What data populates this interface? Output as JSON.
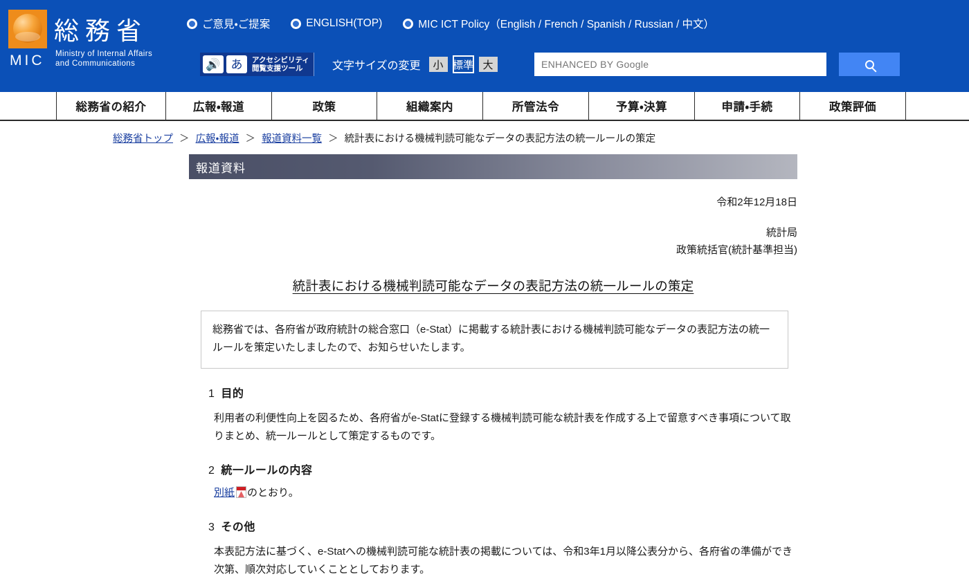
{
  "header": {
    "logo": {
      "mark_name": "mic-sphere-logo",
      "abbr": "MIC",
      "ministry_jp": "総務省",
      "ministry_en_line1": "Ministry of Internal Affairs",
      "ministry_en_line2": "and Communications"
    },
    "top_links": [
      {
        "label": "ご意見・ご提案"
      },
      {
        "label": "ENGLISH(TOP)"
      },
      {
        "label": "MIC ICT Policy（English / French / Spanish / Russian / 中文）"
      }
    ],
    "accessibility": {
      "speaker_glyph": "◀))",
      "kana_glyph": "あ",
      "label_line1": "アクセシビリティ",
      "label_line2": "閲覧支援ツール"
    },
    "font_size": {
      "label": "文字サイズの変更",
      "options": [
        {
          "label": "小",
          "selected": false
        },
        {
          "label": "標準",
          "selected": true
        },
        {
          "label": "大",
          "selected": false
        }
      ]
    },
    "search": {
      "placeholder": "ENHANCED BY Google",
      "value": "",
      "button_icon": "search-icon"
    },
    "colors": {
      "header_blue": "#0b50b7",
      "search_button_blue": "#4285f4",
      "logo_orange": "#ee8c1b"
    }
  },
  "global_nav": {
    "items": [
      {
        "label": "総務省の紹介",
        "width": 158
      },
      {
        "label": "広報・報道",
        "width": 153
      },
      {
        "label": "政策",
        "width": 152
      },
      {
        "label": "組織案内",
        "width": 153
      },
      {
        "label": "所管法令",
        "width": 153
      },
      {
        "label": "予算・決算",
        "width": 153
      },
      {
        "label": "申請・手続",
        "width": 152
      },
      {
        "label": "政策評価",
        "width": 153
      }
    ]
  },
  "breadcrumb": {
    "items": [
      {
        "label": "総務省トップ",
        "is_link": true
      },
      {
        "label": "広報・報道",
        "is_link": true
      },
      {
        "label": "報道資料一覧",
        "is_link": true
      },
      {
        "label": "統計表における機械判読可能なデータの表記方法の統一ルールの策定",
        "is_link": false
      }
    ],
    "separator": "＞"
  },
  "page": {
    "banner_label": "報道資料",
    "date": "令和2年12月18日",
    "issuer_line1": "統計局",
    "issuer_line2": "政策統括官(統計基準担当)",
    "title": "統計表における機械判読可能なデータの表記方法の統一ルールの策定",
    "summary": "総務省では、各府省が政府統計の総合窓口（e-Stat）に掲載する統計表における機械判読可能なデータの表記方法の統一ルールを策定いたしましたので、お知らせいたします。",
    "sections": [
      {
        "number": "1",
        "heading": "目的",
        "body": "利用者の利便性向上を図るため、各府省がe-Statに登録する機械判読可能な統計表を作成する上で留意すべき事項について取りまとめ、統一ルールとして策定するものです。"
      },
      {
        "number": "2",
        "heading": "統一ルールの内容",
        "link_text": "別紙",
        "link_icon": "pdf-icon",
        "body_after_link": "のとおり。"
      },
      {
        "number": "3",
        "heading": "その他",
        "body": "本表記方法に基づく、e-Statへの機械判読可能な統計表の掲載については、令和3年1月以降公表分から、各府省の準備ができ次第、順次対応していくこととしております。"
      }
    ]
  }
}
